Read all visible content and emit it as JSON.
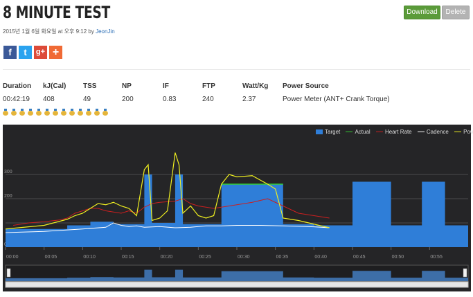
{
  "header": {
    "title": "8 MINUTE TEST",
    "download_label": "Download",
    "delete_label": "Delete"
  },
  "meta": {
    "date_text": "2015년 1월 6일 화요일 at 오후 9:12 by",
    "author": "JeonJin"
  },
  "social": {
    "facebook": "f",
    "twitter": "t",
    "googleplus": "g+",
    "add": "+"
  },
  "stats": {
    "headers": [
      "Duration",
      "kJ(Cal)",
      "TSS",
      "NP",
      "IF",
      "FTP",
      "Watt/Kg",
      "Power Source"
    ],
    "values": [
      "00:42:19",
      "408",
      "49",
      "200",
      "0.83",
      "240",
      "2.37",
      "Power Meter (ANT+ Crank Torque)"
    ]
  },
  "medals": {
    "count": 13
  },
  "colors": {
    "target": "#2f7ed8",
    "actual": "#33cc33",
    "heart_rate": "#cc1f1f",
    "cadence": "#ffffff",
    "power": "#f0f020",
    "chart_bg": "#252527"
  },
  "chart_data": {
    "type": "area",
    "legend": [
      "Target",
      "Actual",
      "Heart Rate",
      "Cadence",
      "Power"
    ],
    "legend_position": "top-right",
    "x_ticks": [
      "00:00",
      "00:05",
      "00:10",
      "00:15",
      "00:20",
      "00:25",
      "00:30",
      "00:35",
      "00:40",
      "00:45",
      "00:50",
      "00:55"
    ],
    "x_range_min": [
      0,
      60
    ],
    "y_range": [
      0,
      420
    ],
    "y_ticks_shown": [
      "300",
      "200",
      "0"
    ],
    "grid": true,
    "series": [
      {
        "name": "Target",
        "points_min_watts": [
          [
            0,
            75
          ],
          [
            8,
            75
          ],
          [
            8,
            90
          ],
          [
            11,
            90
          ],
          [
            11,
            105
          ],
          [
            14,
            105
          ],
          [
            14,
            95
          ],
          [
            18,
            95
          ],
          [
            18,
            300
          ],
          [
            19,
            300
          ],
          [
            19,
            100
          ],
          [
            22,
            100
          ],
          [
            22,
            300
          ],
          [
            23,
            300
          ],
          [
            23,
            95
          ],
          [
            28,
            95
          ],
          [
            28,
            260
          ],
          [
            36,
            260
          ],
          [
            36,
            95
          ],
          [
            40,
            95
          ],
          [
            40,
            90
          ],
          [
            45,
            90
          ],
          [
            45,
            270
          ],
          [
            50,
            270
          ],
          [
            50,
            90
          ],
          [
            54,
            90
          ],
          [
            54,
            270
          ],
          [
            57,
            270
          ],
          [
            57,
            90
          ],
          [
            60,
            90
          ]
        ]
      },
      {
        "name": "Actual",
        "points_min_watts": [
          [
            28,
            260
          ],
          [
            36,
            260
          ]
        ]
      },
      {
        "name": "Heart Rate",
        "points_min_bpm": [
          [
            1,
            90
          ],
          [
            3,
            100
          ],
          [
            5,
            105
          ],
          [
            7,
            112
          ],
          [
            8,
            120
          ],
          [
            9,
            140
          ],
          [
            10,
            150
          ],
          [
            11,
            160
          ],
          [
            12,
            160
          ],
          [
            13,
            150
          ],
          [
            14,
            145
          ],
          [
            15,
            140
          ],
          [
            16,
            150
          ],
          [
            17,
            140
          ],
          [
            18,
            165
          ],
          [
            19,
            180
          ],
          [
            20,
            185
          ],
          [
            22,
            190
          ],
          [
            23,
            200
          ],
          [
            24,
            180
          ],
          [
            25,
            170
          ],
          [
            26,
            165
          ],
          [
            27,
            160
          ],
          [
            28,
            165
          ],
          [
            30,
            175
          ],
          [
            32,
            185
          ],
          [
            34,
            200
          ],
          [
            36,
            170
          ],
          [
            38,
            140
          ],
          [
            40,
            130
          ],
          [
            42,
            120
          ]
        ]
      },
      {
        "name": "Cadence",
        "points_min_rpm": [
          [
            0,
            60
          ],
          [
            5,
            65
          ],
          [
            10,
            75
          ],
          [
            13,
            82
          ],
          [
            14,
            100
          ],
          [
            15,
            90
          ],
          [
            16,
            85
          ],
          [
            17,
            88
          ],
          [
            18,
            82
          ],
          [
            20,
            85
          ],
          [
            22,
            80
          ],
          [
            24,
            82
          ],
          [
            26,
            88
          ],
          [
            28,
            88
          ],
          [
            30,
            90
          ],
          [
            33,
            90
          ],
          [
            36,
            88
          ],
          [
            38,
            86
          ],
          [
            40,
            84
          ],
          [
            42,
            80
          ]
        ]
      },
      {
        "name": "Power",
        "points_min_watts": [
          [
            0,
            75
          ],
          [
            5,
            90
          ],
          [
            8,
            115
          ],
          [
            9,
            130
          ],
          [
            10,
            140
          ],
          [
            11,
            160
          ],
          [
            12,
            180
          ],
          [
            13,
            175
          ],
          [
            14,
            185
          ],
          [
            15,
            170
          ],
          [
            16,
            160
          ],
          [
            17,
            130
          ],
          [
            18,
            320
          ],
          [
            18.5,
            340
          ],
          [
            19,
            110
          ],
          [
            20,
            120
          ],
          [
            21,
            150
          ],
          [
            22,
            390
          ],
          [
            22.5,
            340
          ],
          [
            23,
            140
          ],
          [
            24,
            170
          ],
          [
            25,
            130
          ],
          [
            26,
            120
          ],
          [
            27,
            130
          ],
          [
            28,
            260
          ],
          [
            29,
            300
          ],
          [
            30,
            290
          ],
          [
            32,
            295
          ],
          [
            34,
            260
          ],
          [
            35,
            240
          ],
          [
            36,
            120
          ],
          [
            38,
            110
          ],
          [
            40,
            95
          ],
          [
            42,
            80
          ]
        ]
      }
    ]
  }
}
